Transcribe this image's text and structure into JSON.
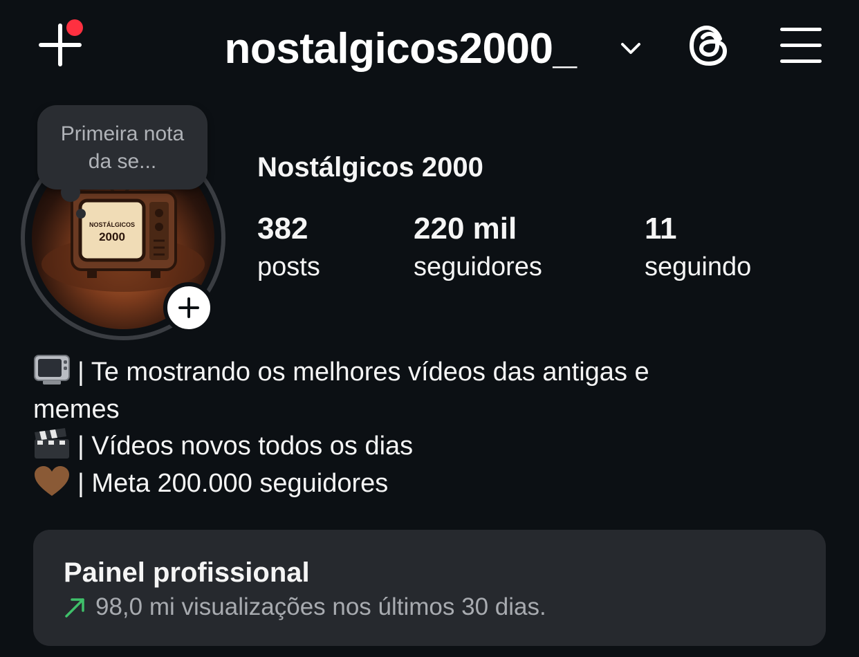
{
  "header": {
    "username": "nostalgicos2000_",
    "new_post_icon": "plus-icon",
    "switch_account_icon": "chevron-down-icon",
    "threads_icon": "threads-icon",
    "menu_icon": "hamburger-menu-icon",
    "notification_color": "#ff3040"
  },
  "profile": {
    "note": "Primeira nota da se...",
    "avatar_logo_line1": "NOSTÁLGICOS",
    "avatar_logo_line2": "2000",
    "display_name": "Nostálgicos 2000",
    "stats": [
      {
        "value": "382",
        "label": "posts"
      },
      {
        "value": "220 mil",
        "label": "seguidores"
      },
      {
        "value": "11",
        "label": "seguindo"
      }
    ]
  },
  "bio": {
    "lines": [
      {
        "emoji": "tv-icon",
        "text": "| Te mostrando os melhores vídeos das antigas e"
      },
      {
        "emoji": "",
        "text": "memes"
      },
      {
        "emoji": "clapperboard-icon",
        "text": "| Vídeos novos todos os dias"
      },
      {
        "emoji": "brown-heart-icon",
        "text": "| Meta 200.000 seguidores"
      }
    ]
  },
  "professional_panel": {
    "title": "Painel profissional",
    "summary": "98,0 mi visualizações nos últimos 30 dias.",
    "trend_icon": "trend-up-arrow-icon",
    "trend_color": "#3fc06a"
  }
}
